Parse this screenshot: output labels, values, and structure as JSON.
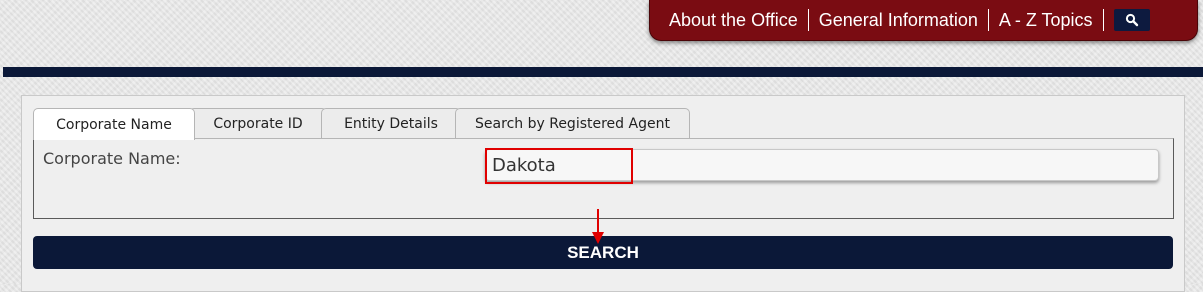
{
  "header_nav": {
    "items": [
      {
        "label": "About the Office"
      },
      {
        "label": "General Information"
      },
      {
        "label": "A - Z Topics"
      }
    ],
    "search_icon": "search-icon",
    "background_color": "#7a0c12",
    "search_button_color": "#0d1a3f"
  },
  "tabs": [
    {
      "label": "Corporate Name",
      "active": true
    },
    {
      "label": "Corporate ID",
      "active": false
    },
    {
      "label": "Entity Details",
      "active": false
    },
    {
      "label": "Search by Registered Agent",
      "active": false
    }
  ],
  "form": {
    "field_label": "Corporate Name:",
    "field_value": "Dakota"
  },
  "search_button": {
    "label": "SEARCH"
  },
  "annotations": {
    "highlight_color": "#e00000",
    "arrow_icon": "arrow-down-icon"
  },
  "colors": {
    "navy": "#0b1838",
    "panel": "#efefef"
  }
}
